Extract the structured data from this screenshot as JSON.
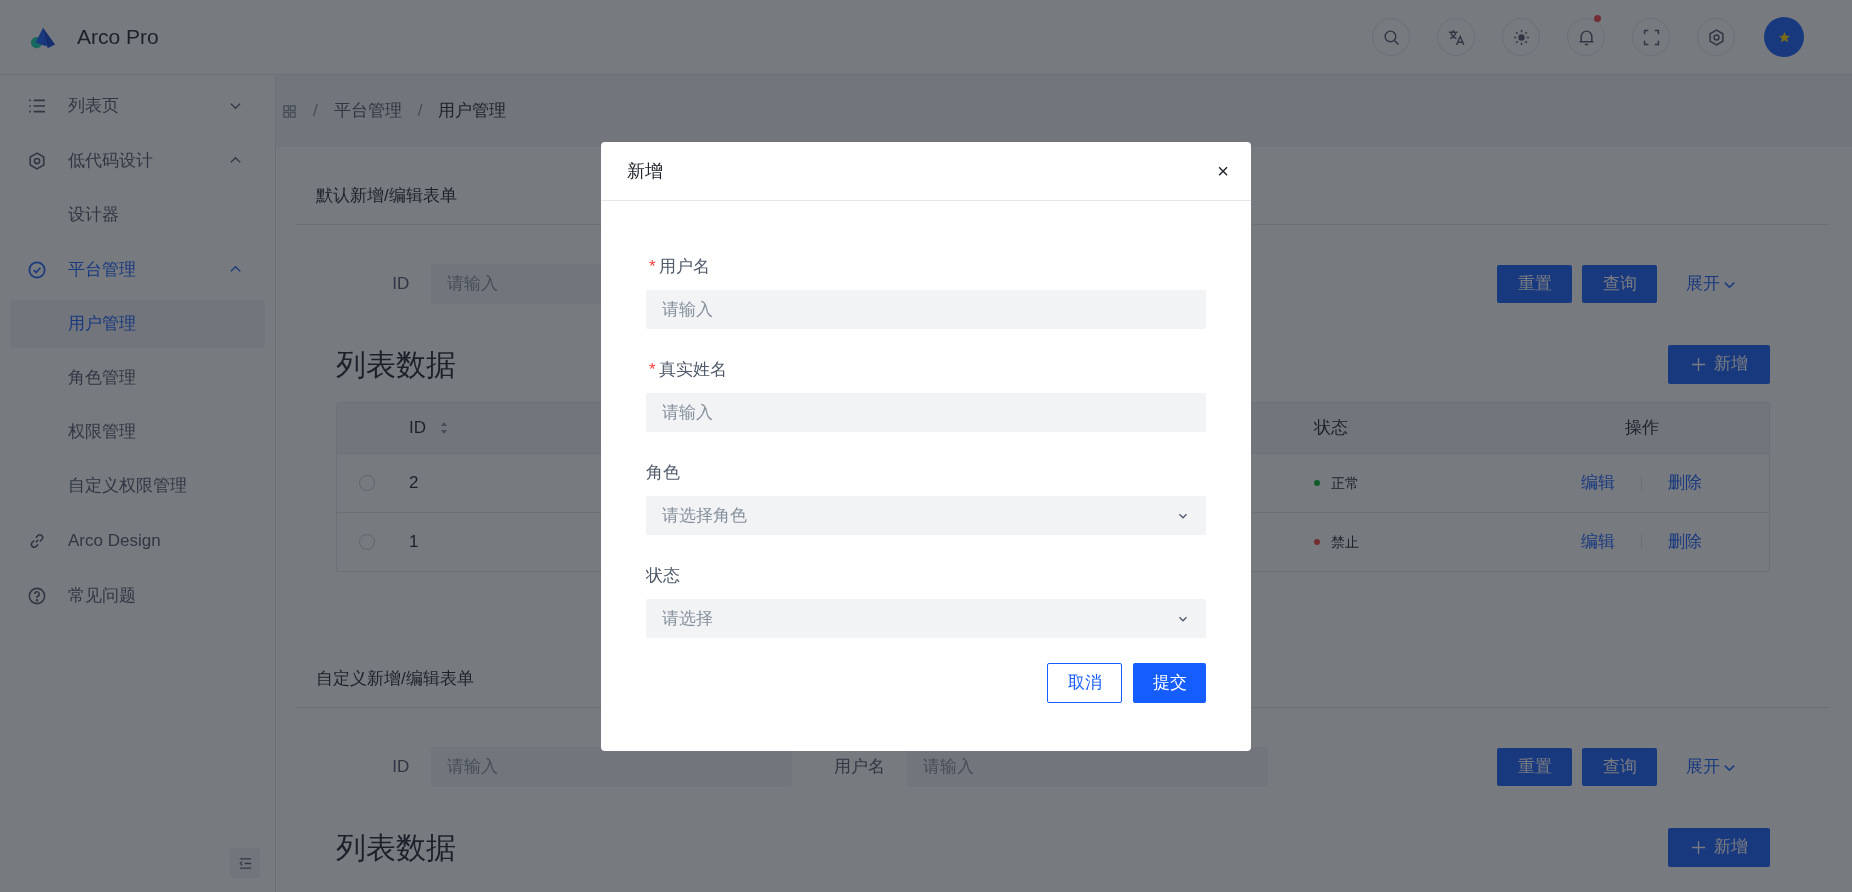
{
  "app": {
    "title": "Arco Pro"
  },
  "sidebar": {
    "items": [
      {
        "label": "列表页",
        "expanded": false
      },
      {
        "label": "低代码设计",
        "expanded": true,
        "children": [
          {
            "label": "设计器",
            "selected": false
          }
        ]
      },
      {
        "label": "平台管理",
        "expanded": true,
        "children": [
          {
            "label": "用户管理",
            "selected": true
          },
          {
            "label": "角色管理",
            "selected": false
          },
          {
            "label": "权限管理",
            "selected": false
          },
          {
            "label": "自定义权限管理",
            "selected": false
          }
        ]
      },
      {
        "label": "Arco Design"
      },
      {
        "label": "常见问题"
      }
    ]
  },
  "breadcrumb": {
    "separator": "/",
    "items": [
      "平台管理",
      "用户管理"
    ]
  },
  "sections": [
    {
      "title": "默认新增/编辑表单",
      "fields": [
        {
          "label": "ID",
          "placeholder": "请输入"
        }
      ],
      "buttons": [
        "重置",
        "查询"
      ],
      "expand": "展开",
      "list_title": "列表数据",
      "add_button": "新增",
      "table": {
        "columns": [
          "ID",
          "状态",
          "操作"
        ],
        "rows": [
          {
            "id": "2",
            "selected": false,
            "status": "正常",
            "color": "#115c29",
            "actions": [
              "编辑",
              "删除"
            ]
          },
          {
            "id": "1",
            "selected": false,
            "status": "禁止",
            "color": "#732d32",
            "actions": [
              "编辑",
              "删除"
            ]
          }
        ]
      }
    },
    {
      "title": "自定义新增/编辑表单",
      "fields": [
        {
          "label": "ID",
          "placeholder": "请输入"
        },
        {
          "label": "用户名",
          "placeholder": "请输入"
        }
      ],
      "buttons": [
        "重置",
        "查询"
      ],
      "expand": "展开",
      "list_title": "列表数据",
      "add_button": "新增"
    }
  ],
  "modal": {
    "title": "新增",
    "close": "×",
    "required_mark": "*",
    "fields": [
      {
        "label": "用户名",
        "required": true,
        "kind": "input",
        "placeholder": "请输入"
      },
      {
        "label": "真实姓名",
        "required": true,
        "kind": "input",
        "placeholder": "请输入"
      },
      {
        "label": "角色",
        "required": false,
        "kind": "select",
        "placeholder": "请选择角色"
      },
      {
        "label": "状态",
        "required": false,
        "kind": "select",
        "placeholder": "请选择"
      }
    ],
    "buttons": [
      "取消",
      "提交"
    ]
  }
}
